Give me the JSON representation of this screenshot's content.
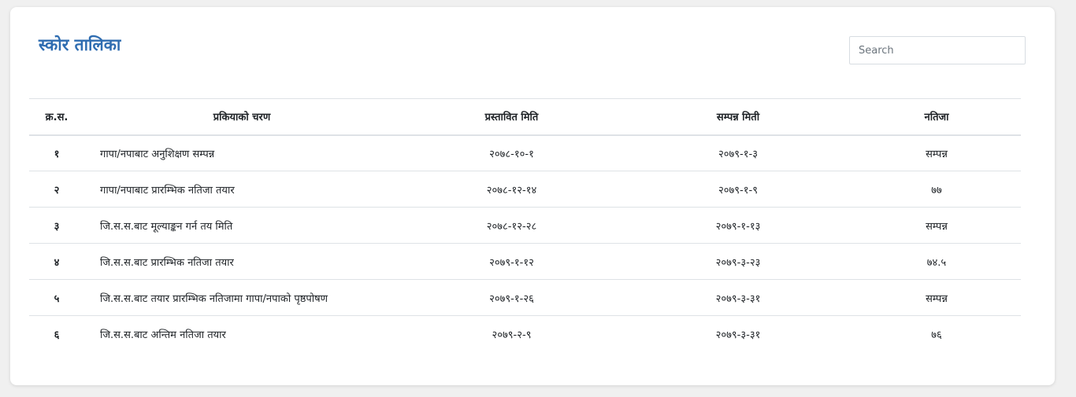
{
  "page": {
    "title": "स्कोर तालिका",
    "search_placeholder": "Search"
  },
  "colors": {
    "title": "#2f6db1",
    "border": "#dee2e6",
    "background": "#f0f0f0"
  },
  "table": {
    "headers": {
      "sn": "क्र.स.",
      "stage": "प्रकियाको चरण",
      "proposed_date": "प्रस्तावित मिति",
      "completed_date": "सम्पन्न मिती",
      "result": "नतिजा"
    },
    "rows": [
      {
        "sn": "१",
        "stage": "गापा/नपाबाट अनुशिक्षण सम्पन्न",
        "proposed_date": "२०७८-१०-१",
        "completed_date": "२०७९-१-३",
        "result": "सम्पन्न"
      },
      {
        "sn": "२",
        "stage": "गापा/नपाबाट प्रारम्भिक नतिजा तयार",
        "proposed_date": "२०७८-१२-१४",
        "completed_date": "२०७९-१-९",
        "result": "७७"
      },
      {
        "sn": "३",
        "stage": "जि.स.स.बाट मूल्याङ्कन गर्न तय मिति",
        "proposed_date": "२०७८-१२-२८",
        "completed_date": "२०७९-१-१३",
        "result": "सम्पन्न"
      },
      {
        "sn": "४",
        "stage": "जि.स.स.बाट प्रारम्भिक नतिजा तयार",
        "proposed_date": "२०७९-१-१२",
        "completed_date": "२०७९-३-२३",
        "result": "७४.५"
      },
      {
        "sn": "५",
        "stage": "जि.स.स.बाट तयार प्रारम्भिक नतिजामा गापा/नपाको पृष्ठपोषण",
        "proposed_date": "२०७९-१-२६",
        "completed_date": "२०७९-३-३१",
        "result": "सम्पन्न"
      },
      {
        "sn": "६",
        "stage": "जि.स.स.बाट अन्तिम नतिजा तयार",
        "proposed_date": "२०७९-२-९",
        "completed_date": "२०७९-३-३१",
        "result": "७६"
      }
    ]
  }
}
